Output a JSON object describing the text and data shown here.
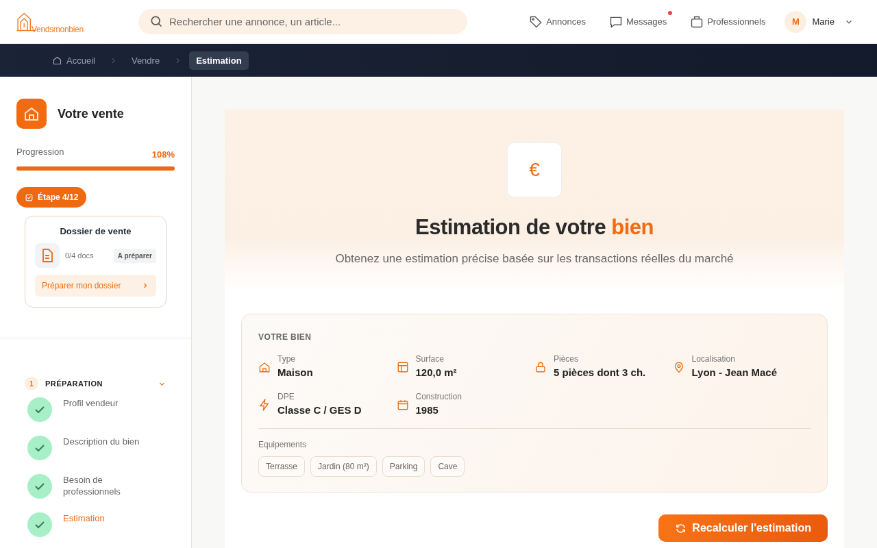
{
  "header": {
    "logo": "Vendsmonbien",
    "search": {
      "placeholder": "Rechercher une annonce, un article..."
    },
    "nav": [
      {
        "kind": "tag",
        "label": "Annonces",
        "unread": false
      },
      {
        "kind": "chat",
        "label": "Messages",
        "unread": true
      },
      {
        "kind": "briefcase",
        "label": "Professionnels",
        "unread": false
      }
    ],
    "user": {
      "initial": "M",
      "name": "Marie"
    }
  },
  "breadcrumb": [
    {
      "label": "Accueil",
      "selected": false
    },
    {
      "label": "Vendre",
      "selected": false
    },
    {
      "label": "Estimation",
      "selected": true
    }
  ],
  "sidebar": {
    "title": "Votre vente",
    "progress_label": "Progression",
    "progress_value": "108%",
    "level": 1,
    "step_badge": "Étape 4/12",
    "dossier": {
      "title": "Dossier de vente",
      "docs": "0/4 docs",
      "status": "A préparer",
      "action": "Préparer mon dossier"
    },
    "section": {
      "number": "1",
      "title": "PRÉPARATION",
      "expanded": true,
      "steps": [
        {
          "label": "Profil vendeur",
          "done": true,
          "selected": false
        },
        {
          "label": "Description du bien",
          "done": true,
          "selected": false
        },
        {
          "label": "Besoin de professionnels",
          "done": true,
          "selected": false
        },
        {
          "label": "Estimation",
          "done": true,
          "selected": true
        }
      ]
    }
  },
  "hero": {
    "symbol": "€",
    "title": "Estimation de votre",
    "title_highlight": "bien",
    "subtitle": "Obtenez une estimation précise basée sur les transactions réelles du marché"
  },
  "property": {
    "heading": "VOTRE BIEN",
    "fields": [
      {
        "kind": "house",
        "label": "Type",
        "value": "Maison"
      },
      {
        "kind": "layout",
        "label": "Surface",
        "value": "120,0 m²"
      },
      {
        "kind": "lock",
        "label": "Pièces",
        "value": "5 pièces dont 3 ch."
      },
      {
        "kind": "pin",
        "label": "Localisation",
        "value": "Lyon - Jean Macé"
      },
      {
        "kind": "bolt",
        "label": "DPE",
        "value": "Classe C / GES D"
      },
      {
        "kind": "calendar",
        "label": "Construction",
        "value": "1985"
      }
    ],
    "equipment_label": "Equipements",
    "equipment": [
      "Terrasse",
      "Jardin (80 m²)",
      "Parking",
      "Cave"
    ]
  },
  "action": "Recalculer l'estimation"
}
